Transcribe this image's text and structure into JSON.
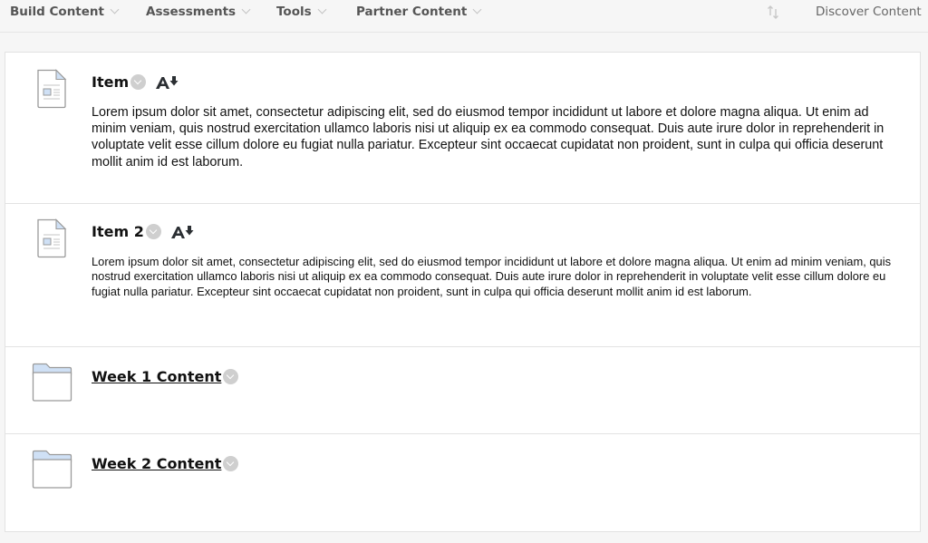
{
  "toolbar": {
    "menus": [
      {
        "label": "Build Content",
        "icon": "chevron-down-icon"
      },
      {
        "label": "Assessments",
        "icon": "chevron-down-icon"
      },
      {
        "label": "Tools",
        "icon": "chevron-down-icon"
      },
      {
        "label": "Partner Content",
        "icon": "chevron-down-icon"
      }
    ],
    "sort_icon": "sort-arrows-icon",
    "discover_label": "Discover Content"
  },
  "items": [
    {
      "type": "item",
      "icon": "document-icon",
      "title": "Item",
      "description": "Lorem ipsum dolor sit amet, consectetur adipiscing elit, sed do eiusmod tempor incididunt ut labore et dolore magna aliqua. Ut enim ad minim veniam, quis nostrud exercitation ullamco laboris nisi ut aliquip ex ea commodo consequat. Duis aute irure dolor in reprehenderit in voluptate velit esse cillum dolore eu fugiat nulla pariatur. Excepteur sint occaecat cupidatat non proident, sunt in culpa qui officia deserunt mollit anim id est laborum."
    },
    {
      "type": "item",
      "icon": "document-icon",
      "title": "Item 2",
      "description": "Lorem ipsum dolor sit amet, consectetur adipiscing elit, sed do eiusmod tempor incididunt ut labore et dolore magna aliqua. Ut enim ad minim veniam, quis nostrud exercitation ullamco laboris nisi ut aliquip ex ea commodo consequat. Duis aute irure dolor in reprehenderit in voluptate velit esse cillum dolore eu fugiat nulla pariatur. Excepteur sint occaecat cupidatat non proident, sunt in culpa qui officia deserunt mollit anim id est laborum."
    },
    {
      "type": "folder",
      "icon": "folder-icon",
      "title": "Week 1 Content"
    },
    {
      "type": "folder",
      "icon": "folder-icon",
      "title": "Week 2 Content"
    }
  ],
  "colors": {
    "page_bg": "#f6f6f6",
    "panel_bg": "#ffffff",
    "menu_text": "#555555",
    "folder_tab": "#cfe0f5",
    "doc_corner": "#cfe0f5"
  }
}
